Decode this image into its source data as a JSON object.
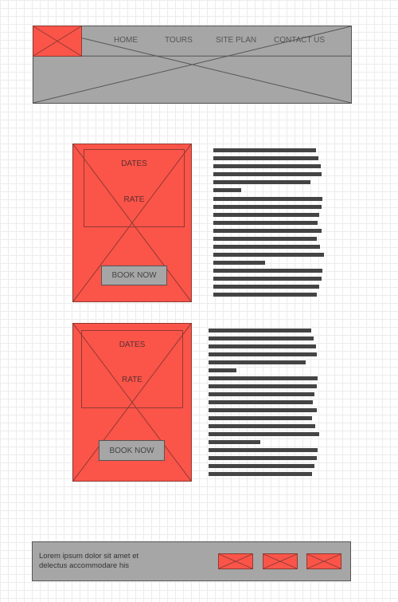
{
  "header": {
    "nav": [
      "HOME",
      "TOURS",
      "SITE PLAN",
      "CONTACT US"
    ]
  },
  "tours": [
    {
      "dates_label": "DATES",
      "rate_label": "RATE",
      "book_label": "BOOK NOW"
    },
    {
      "dates_label": "DATES",
      "rate_label": "RATE",
      "book_label": "BOOK NOW"
    }
  ],
  "footer": {
    "text": "Lorem ipsum dolor sit amet et delectus accommodare his"
  },
  "colors": {
    "placeholder_red": "#fb5449",
    "placeholder_grey": "#a6a6a6",
    "text_bar": "#444444"
  },
  "icons": [
    "image-placeholder-icon",
    "social-icon"
  ]
}
